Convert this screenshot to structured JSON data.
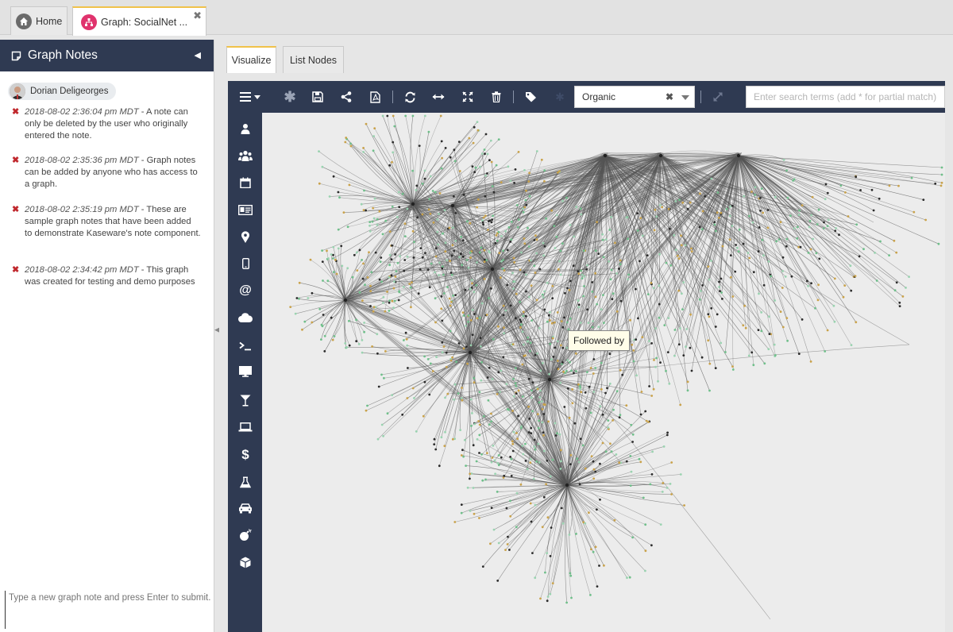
{
  "tabs": {
    "home_label": "Home",
    "graph_label": "Graph: SocialNet ..."
  },
  "notes_panel": {
    "title": "Graph Notes",
    "user_name": "Dorian Deligeorges",
    "notes": [
      {
        "timestamp": "2018-08-02 2:36:04 pm MDT",
        "text": " - A note can only be deleted by the user who originally entered the note."
      },
      {
        "timestamp": "2018-08-02 2:35:36 pm MDT",
        "text": " - Graph notes can be added by anyone who has access to a graph."
      },
      {
        "timestamp": "2018-08-02 2:35:19 pm MDT",
        "text": " - These are sample graph notes that have been added to demonstrate Kaseware's note component."
      },
      {
        "timestamp": "2018-08-02 2:34:42 pm MDT",
        "text": " - This graph was created for testing and demo purposes"
      }
    ],
    "input_placeholder": "Type a new graph note and press Enter to submit."
  },
  "view_tabs": {
    "visualize": "Visualize",
    "list_nodes": "List Nodes"
  },
  "toolbar": {
    "layout_value": "Organic",
    "search_placeholder": "Enter search terms (add * for partial match)"
  },
  "graph": {
    "tooltip": "Followed by",
    "edge_color": "#555555",
    "node_colors": [
      "#6fbf8a",
      "#2b2b2b",
      "#9ad3b0",
      "#c9a24a"
    ]
  },
  "colors": {
    "navy": "#2f3a52",
    "accent_tab": "#f0c24a",
    "graph_tab_icon": "#e0336d",
    "delete_red": "#c0282d"
  }
}
